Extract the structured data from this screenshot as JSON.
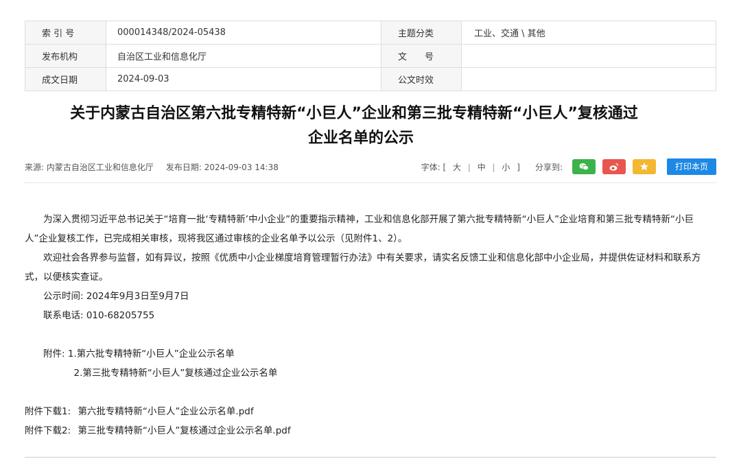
{
  "meta": {
    "index_label": "索 引 号",
    "index_value": "000014348/2024-05438",
    "topic_label": "主题分类",
    "topic_value": "工业、交通 \\ 其他",
    "org_label": "发布机构",
    "org_value": "自治区工业和信息化厅",
    "doc_no_label": "文　　号",
    "doc_no_value": "",
    "date_label": "成文日期",
    "date_value": "2024-09-03",
    "validity_label": "公文时效",
    "validity_value": ""
  },
  "title": {
    "line1": "关于内蒙古自治区第六批专精特新“小巨人”企业和第三批专精特新“小巨人”复核通过",
    "line2": "企业名单的公示"
  },
  "info": {
    "source": "来源:  内蒙古自治区工业和信息化厅",
    "publish": "发布日期:  2024-09-03 14:38",
    "font_label": "字体:  [",
    "font_large": "大",
    "font_medium": "中",
    "font_small": "小",
    "font_end": "]",
    "share_label": "分享到:",
    "print_label": "打印本页"
  },
  "share": {
    "wechat_color": "#3cb34a",
    "weibo_color": "#e9554f",
    "fav_color": "#f4b731"
  },
  "content": {
    "p1": "为深入贯彻习近平总书记关于“培育一批‘专精特新’中小企业”的重要指示精神，工业和信息化部开展了第六批专精特新“小巨人”企业培育和第三批专精特新“小巨人”企业复核工作，已完成相关审核，现将我区通过审核的企业名单予以公示（见附件1、2）。",
    "p2": "欢迎社会各界参与监督，如有异议，按照《优质中小企业梯度培育管理暂行办法》中有关要求，请实名反馈工业和信息化部中小企业局，并提供佐证材料和联系方式，以便核实查证。",
    "period": "公示时间:  2024年9月3日至9月7日",
    "phone": "联系电话:  010-68205755",
    "att1": "附件:  1.第六批专精特新“小巨人”企业公示名单",
    "att2": "2.第三批专精特新“小巨人”复核通过企业公示名单"
  },
  "downloads": {
    "d1_label": "附件下载1:",
    "d1_file": "第六批专精特新“小巨人”企业公示名单.pdf",
    "d2_label": "附件下载2:",
    "d2_file": "第三批专精特新“小巨人”复核通过企业公示名单.pdf"
  }
}
